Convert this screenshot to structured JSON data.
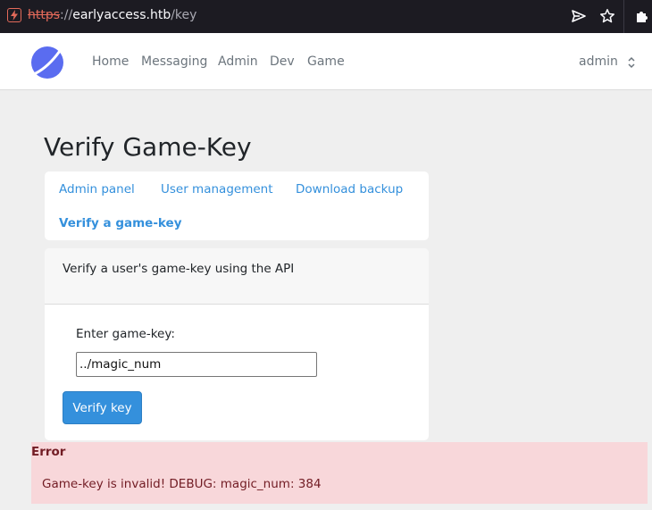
{
  "browser": {
    "url_scheme": "https",
    "url_separator": "://",
    "url_host": "earlyaccess.htb",
    "url_path": "/key"
  },
  "nav": {
    "links": [
      "Home",
      "Messaging",
      "Admin",
      "Dev",
      "Game"
    ],
    "user": "admin"
  },
  "page": {
    "title": "Verify Game-Key",
    "tabs": [
      "Admin panel",
      "User management",
      "Download backup",
      "Verify a game-key"
    ],
    "active_tab": "Verify a game-key"
  },
  "card": {
    "header": "Verify a user's game-key using the API",
    "label": "Enter game-key:",
    "input_value": "../magic_num",
    "button": "Verify key"
  },
  "alert": {
    "title": "Error",
    "message": "Game-key is invalid! DEBUG: magic_num: 384"
  },
  "colors": {
    "accent": "#3490dc",
    "error_bg": "#f8d7da",
    "error_text": "#721c24"
  }
}
